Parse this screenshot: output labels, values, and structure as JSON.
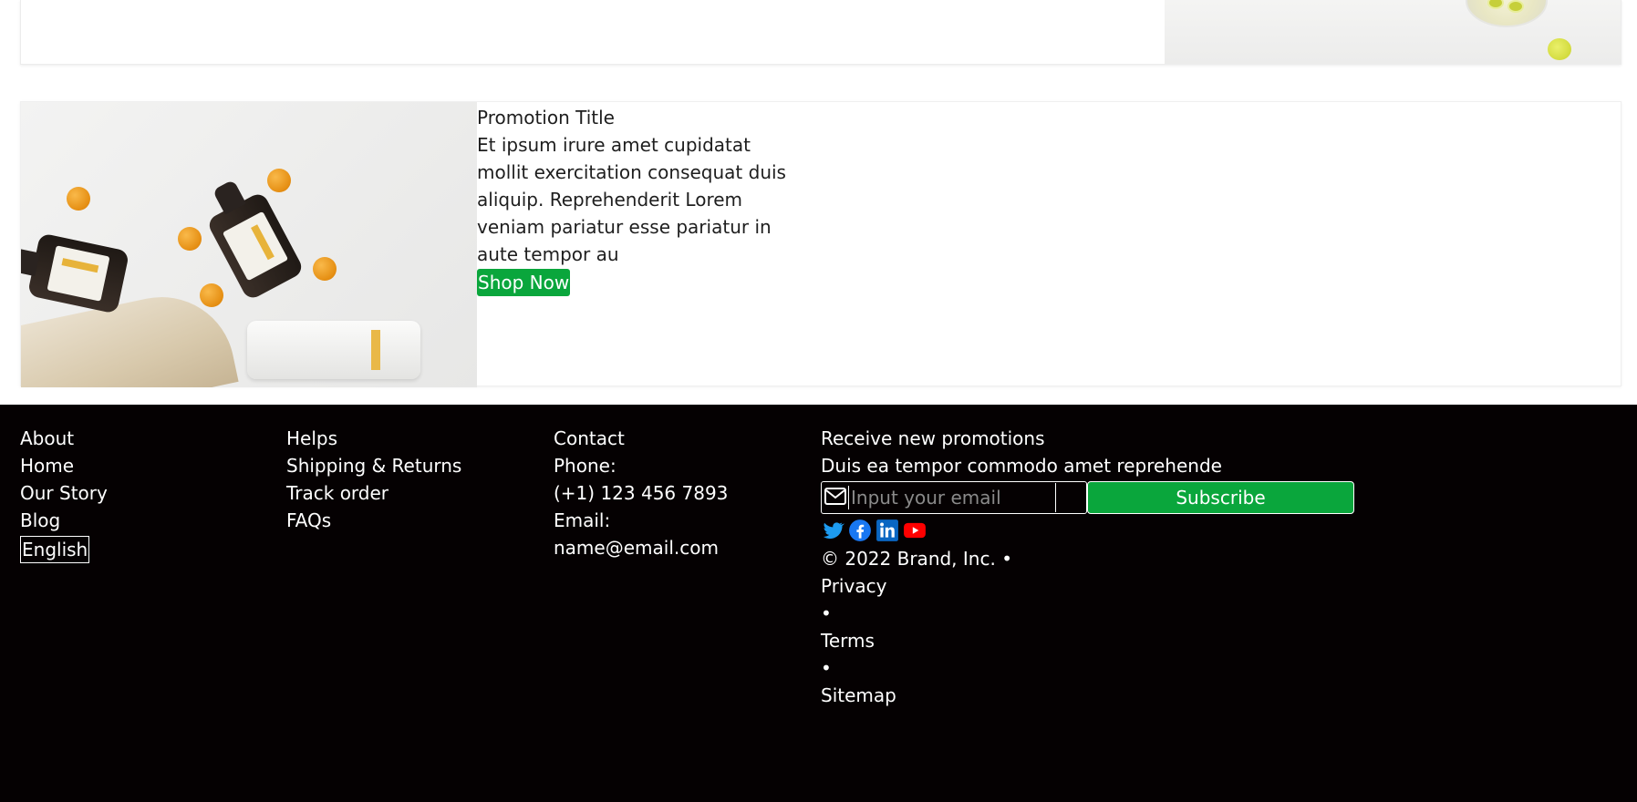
{
  "promotion": {
    "title": "Promotion Title",
    "body": "Et ipsum irure amet cupidatat mollit exercitation consequat duis aliquip. Reprehenderit Lorem veniam pariatur esse pariatur in aute tempor au",
    "button_label": "Shop Now",
    "image_icon": "promotion-product-photo"
  },
  "footer": {
    "col1": {
      "items": [
        "About",
        "Home",
        "Our Story",
        "Blog"
      ],
      "language": "English"
    },
    "col2": {
      "items": [
        "Helps",
        "Shipping & Returns",
        "Track order",
        "FAQs"
      ]
    },
    "col3": {
      "heading": "Contact",
      "phone_label": "Phone:",
      "phone": "(+1) 123 456 7893",
      "email_label": "Email:",
      "email": "name@email.com"
    },
    "newsletter": {
      "heading": "Receive new promotions",
      "subtext": "Duis ea tempor commodo amet reprehende",
      "email_placeholder": "Input your email",
      "subscribe_label": "Subscribe"
    },
    "socials": [
      "twitter-icon",
      "facebook-icon",
      "linkedin-icon",
      "youtube-icon"
    ],
    "copyright": "© 2022 Brand, Inc.",
    "links": [
      "Privacy",
      "Terms",
      "Sitemap"
    ],
    "separator": "•"
  },
  "colors": {
    "accent_green": "#0aa63c",
    "footer_bg": "#050102"
  }
}
